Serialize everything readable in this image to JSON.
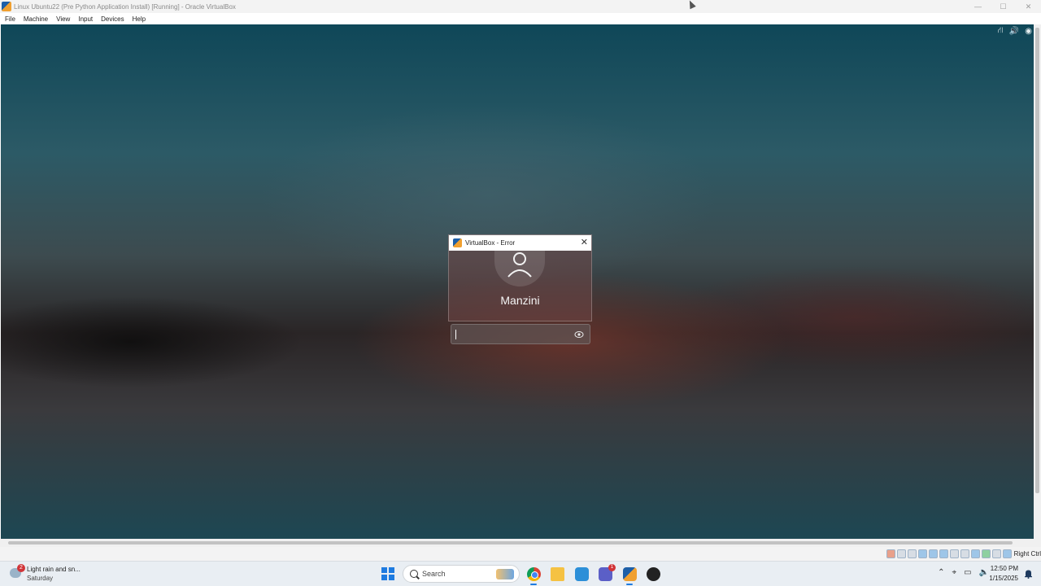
{
  "window": {
    "title": "Linux Ubuntu22 (Pre Python Application Install) [Running] - Oracle VirtualBox",
    "controls": {
      "minimize": "—",
      "maximize": "☐",
      "close": "✕"
    }
  },
  "menubar": {
    "items": [
      "File",
      "Machine",
      "View",
      "Input",
      "Devices",
      "Help"
    ]
  },
  "vm_tray_icons": {
    "network": "⛙",
    "volume": "🔊",
    "accessibility": "◉"
  },
  "error_dialog": {
    "title": "VirtualBox - Error",
    "close": "✕"
  },
  "login": {
    "username": "Manzini",
    "password_value": ""
  },
  "statusbar": {
    "host_key": "Right Ctrl"
  },
  "taskbar": {
    "weather": {
      "badge": "2",
      "line1": "Light rain and sn...",
      "line2": "Saturday"
    },
    "search_placeholder": "Search",
    "badges": {
      "teams": "1",
      "chrome": "",
      "github": ""
    },
    "tray": {
      "chevron": "⌃",
      "location": "⌖",
      "network": "▭",
      "volume": "🔈"
    },
    "clock": {
      "time": "12:50 PM",
      "date": "1/15/2025"
    }
  },
  "colors": {
    "accent": "#1e7be0",
    "badge_red": "#d13438",
    "titlebar_bg": "#f3f3f3"
  }
}
